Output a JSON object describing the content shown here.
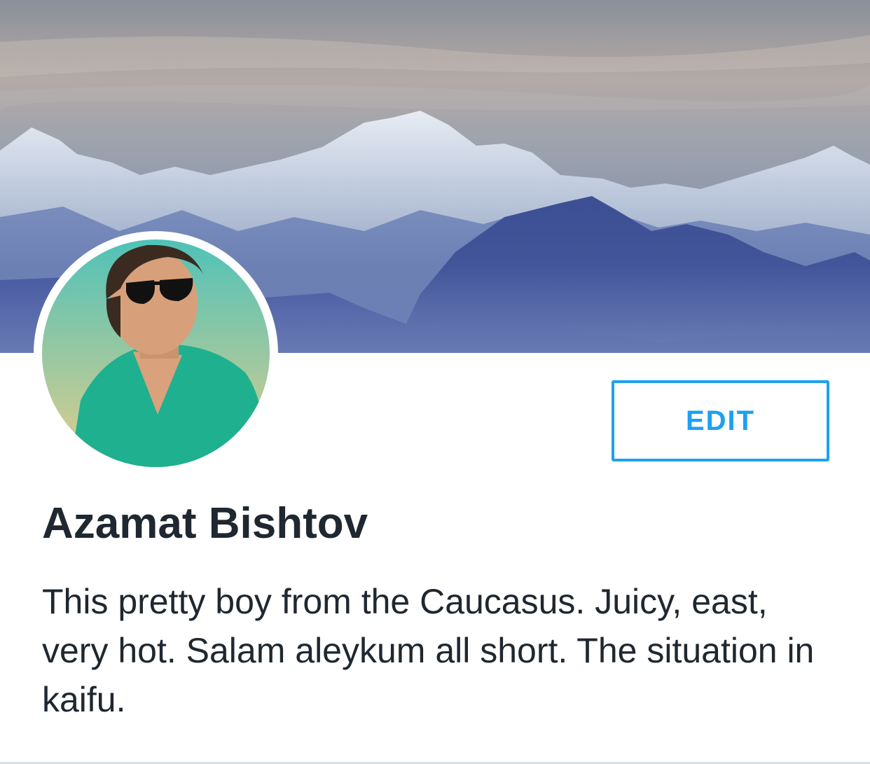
{
  "profile": {
    "name": "Azamat Bishtov",
    "bio": "This pretty boy from the Caucasus. Juicy, east, very hot. Salam aleykum all short. The situation in kaifu.",
    "edit_label": "EDIT"
  },
  "colors": {
    "accent": "#1da1f2",
    "text": "#1f2730",
    "divider": "#dcdfe3"
  },
  "icons": {
    "cover": "mountain-landscape-image",
    "avatar": "user-photo"
  }
}
